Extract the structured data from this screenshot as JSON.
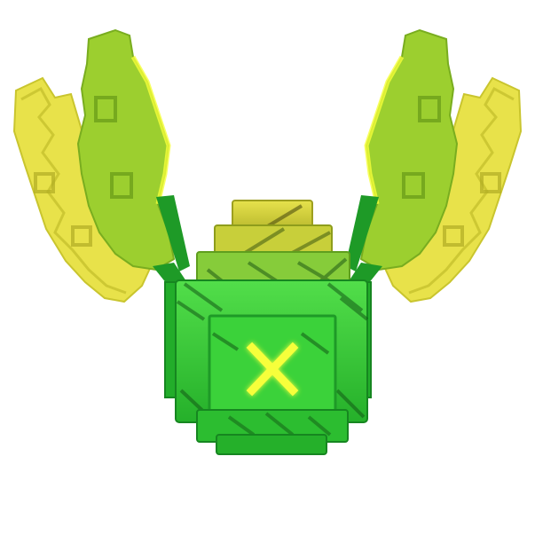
{
  "scene": {
    "subject": "voxel-pet-render",
    "background": "#ffffff"
  },
  "palette": {
    "body_green": "#2fc72f",
    "body_dark": "#1e9a27",
    "body_light": "#52de4a",
    "cap_yellow": "#d6d43a",
    "cap_yellow_dark": "#a8aa22",
    "wing_yellow": "#e8e24a",
    "wing_yellow_light": "#f3ef6c",
    "wing_green": "#9ccf2f",
    "wing_green_dark": "#79ad1f",
    "glow_yellow": "#f6ff3a",
    "seam_dark": "#135a16"
  },
  "icons": {
    "face_mark": "x-mark-icon"
  }
}
